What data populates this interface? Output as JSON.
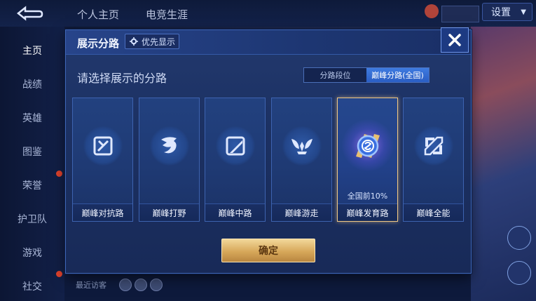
{
  "top_tabs": [
    "个人主页",
    "电竞生涯"
  ],
  "settings": {
    "label": "设置"
  },
  "left_nav": [
    "主页",
    "战绩",
    "英雄",
    "图鉴",
    "荣誉",
    "护卫队",
    "游戏",
    "社交"
  ],
  "visitors_label": "最近访客",
  "modal": {
    "title": "展示分路",
    "priority_label": "优先显示",
    "subtitle": "请选择展示的分路",
    "segments": [
      {
        "label": "分路段位",
        "active": false
      },
      {
        "label": "巅峰分路(全国)",
        "active": true
      }
    ],
    "cards": [
      {
        "label": "巅峰对抗路",
        "icon": "lane-clash-icon",
        "selected": false,
        "rank": ""
      },
      {
        "label": "巅峰打野",
        "icon": "jungle-dragon-icon",
        "selected": false,
        "rank": ""
      },
      {
        "label": "巅峰中路",
        "icon": "mid-lane-icon",
        "selected": false,
        "rank": ""
      },
      {
        "label": "巅峰游走",
        "icon": "roam-wings-icon",
        "selected": false,
        "rank": ""
      },
      {
        "label": "巅峰发育路",
        "icon": "farm-lane-medal-icon",
        "selected": true,
        "rank": "全国前10%"
      },
      {
        "label": "巅峰全能",
        "icon": "all-round-icon",
        "selected": false,
        "rank": ""
      }
    ],
    "confirm_label": "确定"
  },
  "colors": {
    "accent": "#2a5ec4",
    "selected_border": "#f0c884",
    "confirm_gold": "#d7a85a"
  }
}
